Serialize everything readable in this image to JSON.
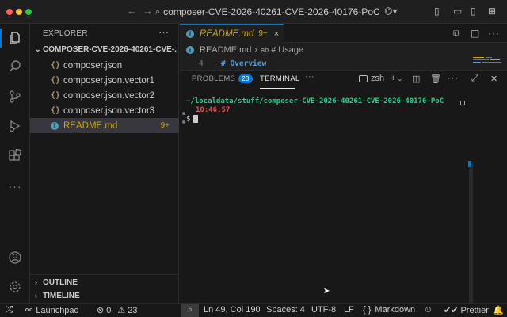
{
  "titlebar": {
    "search_text": "composer-CVE-2026-40261-CVE-2026-40176-PoC",
    "back_icon": "arrow-left-icon",
    "forward_icon": "arrow-right-icon"
  },
  "activitybar": {
    "items": [
      "explorer-icon",
      "search-icon",
      "source-control-icon",
      "run-debug-icon",
      "extensions-icon",
      "more-icon"
    ],
    "bottom": [
      "account-icon",
      "settings-icon"
    ]
  },
  "sidebar": {
    "title": "EXPLORER",
    "more": "···",
    "folder": "COMPOSER-CVE-2026-40261-CVE-...",
    "files": [
      {
        "icon": "{}",
        "name": "composer.json"
      },
      {
        "icon": "{}",
        "name": "composer.json.vector1"
      },
      {
        "icon": "{}",
        "name": "composer.json.vector2"
      },
      {
        "icon": "{}",
        "name": "composer.json.vector3"
      },
      {
        "icon": "i",
        "name": "README.md",
        "badge": "9+"
      }
    ],
    "outline": "OUTLINE",
    "timeline": "TIMELINE"
  },
  "editor": {
    "tab": {
      "name": "README.md",
      "badge": "9+",
      "close": "×"
    },
    "breadcrumb": {
      "file": "README.md",
      "sep": "›",
      "symbol": "# Usage"
    },
    "line_number": "4",
    "line_code": "# Overview"
  },
  "panel": {
    "problems_label": "PROBLEMS",
    "problems_count": "23",
    "terminal_label": "TERMINAL",
    "more": "···",
    "shell": "zsh",
    "add": "+",
    "term_path": "~/localdata/stuff/composer-CVE-2026-40261-CVE-2026-40176-PoC",
    "term_time": "10:46:57",
    "term_prompt": "$"
  },
  "statusbar": {
    "launchpad": "Launchpad",
    "errors": "0",
    "warnings": "23",
    "position": "Ln 49, Col 190",
    "spaces": "Spaces: 4",
    "encoding": "UTF-8",
    "eol": "LF",
    "language_braces": "{ }",
    "language": "Markdown",
    "prettier": "Prettier"
  },
  "colors": {
    "accent": "#0078d4",
    "warning": "#cca700",
    "terminal_path": "#23d18b",
    "terminal_time": "#f14c4c"
  }
}
